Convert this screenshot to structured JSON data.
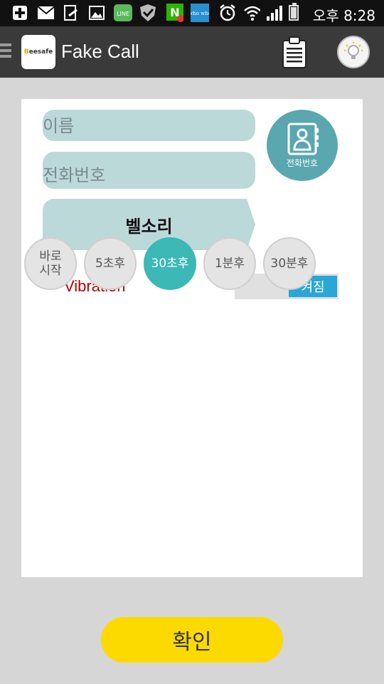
{
  "status_bar": {
    "icons": [
      "plus-icon",
      "mail-icon",
      "file-export-icon",
      "image-icon",
      "line-app-icon",
      "shield-icon",
      "n-app-icon",
      "whowho-icon",
      "alarm-icon",
      "wifi-icon",
      "signal-icon",
      "battery-icon"
    ],
    "line_text": "LINE",
    "whowho_text": "who who",
    "time": "오후 8:28"
  },
  "app_bar": {
    "logo_text": "Beesafe",
    "title": "Fake Call"
  },
  "form": {
    "name_placeholder": "이름",
    "phone_placeholder": "전화번호",
    "ringtone_label": "벨소리",
    "contacts_label": "전화번호"
  },
  "vibration": {
    "label": "Vibration",
    "state": "켜짐"
  },
  "timers": [
    {
      "label": "바로\n시작",
      "line1": "바로",
      "line2": "시작",
      "selected": false
    },
    {
      "label": "5초후",
      "selected": false
    },
    {
      "label": "30초후",
      "selected": true
    },
    {
      "label": "1분후",
      "selected": false
    },
    {
      "label": "30분후",
      "selected": false
    }
  ],
  "confirm_label": "확인",
  "colors": {
    "accent_teal": "#3cb8b6",
    "field_bg": "#bcd9da",
    "confirm_yellow": "#fcda00",
    "vibration_red": "#b40000",
    "toggle_blue": "#2aa6d8"
  }
}
